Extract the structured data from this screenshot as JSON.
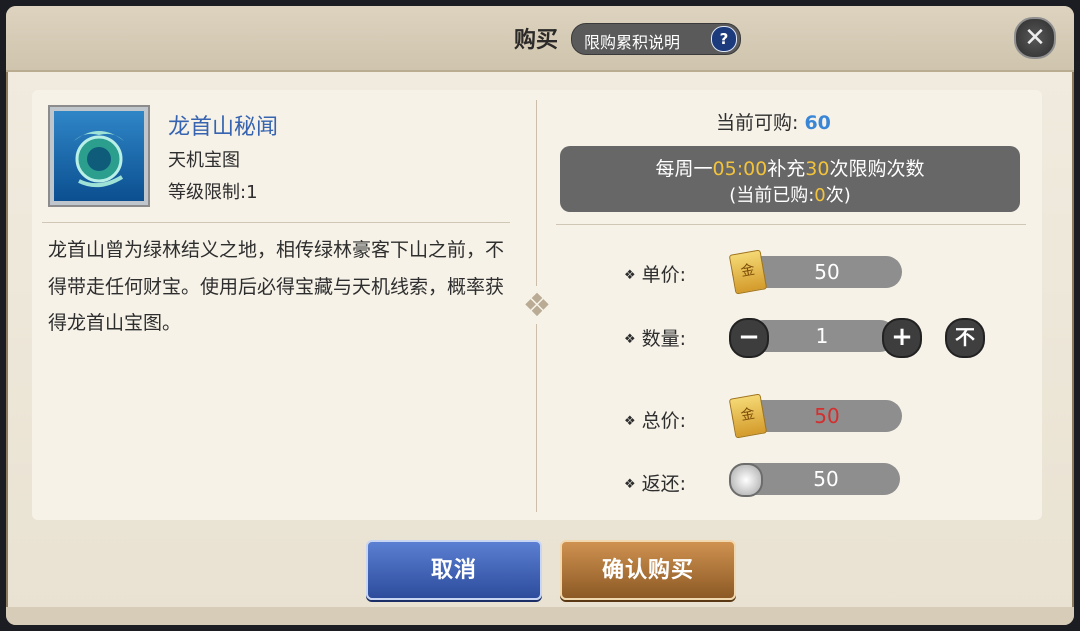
{
  "header": {
    "title": "购买",
    "limit_label": "限购累积说明",
    "help_icon": "question-icon",
    "close_icon": "close-icon"
  },
  "item": {
    "name": "龙首山秘闻",
    "type": "天机宝图",
    "level_limit": "等级限制:1",
    "description": "龙首山曾为绿林结义之地，相传绿林豪客下山之前，不得带走任何财宝。使用后必得宝藏与天机线索，概率获得龙首山宝图。"
  },
  "purchase": {
    "available_label": "当前可购: ",
    "available_value": "60",
    "notice_prefix": "每周一",
    "notice_time": "05:00",
    "notice_mid": "补充",
    "notice_count": "30",
    "notice_suffix": "次限购次数",
    "bought_prefix": "(当前已购:",
    "bought_value": "0",
    "bought_suffix": "次)",
    "unit_price_label": "单价:",
    "unit_price": "50",
    "quantity_label": "数量:",
    "quantity": "1",
    "total_label": "总价:",
    "total": "50",
    "rebate_label": "返还:",
    "rebate": "50",
    "coin_char": "金"
  },
  "buttons": {
    "cancel": "取消",
    "confirm": "确认购买"
  },
  "colors": {
    "available": "#3a86d6",
    "highlight": "#f2c33a",
    "total_price": "#d32f2f"
  }
}
